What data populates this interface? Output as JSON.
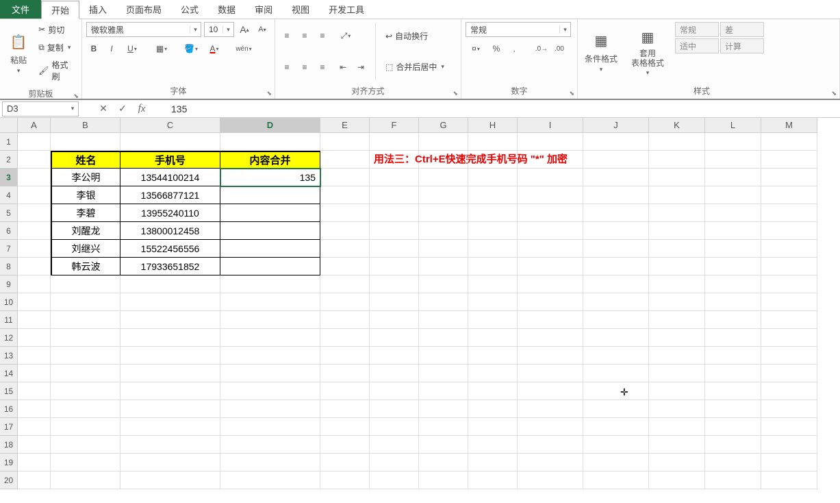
{
  "menu": {
    "file": "文件",
    "tabs": [
      "开始",
      "插入",
      "页面布局",
      "公式",
      "数据",
      "审阅",
      "视图",
      "开发工具"
    ],
    "active": 0
  },
  "ribbon": {
    "clipboard": {
      "label": "剪贴板",
      "paste": "粘贴",
      "cut": "剪切",
      "copy": "复制",
      "format_painter": "格式刷"
    },
    "font": {
      "label": "字体",
      "name": "微软雅黑",
      "size": "10",
      "bold": "B",
      "italic": "I",
      "underline": "U",
      "phonetic": "wén"
    },
    "align": {
      "label": "对齐方式",
      "wrap": "自动换行",
      "merge": "合并后居中"
    },
    "number": {
      "label": "数字",
      "format": "常规"
    },
    "styles": {
      "label": "样式",
      "cond": "条件格式",
      "table": "套用\n表格格式",
      "s1": "常规",
      "s2": "差",
      "s3": "适中",
      "s4": "计算"
    }
  },
  "fx": {
    "namebox": "D3",
    "formula": "135"
  },
  "grid": {
    "cols": [
      "A",
      "B",
      "C",
      "D",
      "E",
      "F",
      "G",
      "H",
      "I",
      "J",
      "K",
      "L",
      "M"
    ],
    "rows": 20,
    "active": {
      "r": 3,
      "c": "D"
    },
    "headers": {
      "b": "姓名",
      "c": "手机号",
      "d": "内容合并"
    },
    "data": [
      {
        "b": "李公明",
        "c": "13544100214",
        "d": "135"
      },
      {
        "b": "李银",
        "c": "13566877121",
        "d": ""
      },
      {
        "b": "李碧",
        "c": "13955240110",
        "d": ""
      },
      {
        "b": "刘醒龙",
        "c": "13800012458",
        "d": ""
      },
      {
        "b": "刘继兴",
        "c": "15522456556",
        "d": ""
      },
      {
        "b": "韩云波",
        "c": "17933651852",
        "d": ""
      }
    ],
    "note": "用法三：Ctrl+E快速完成手机号码 \"*\" 加密"
  }
}
